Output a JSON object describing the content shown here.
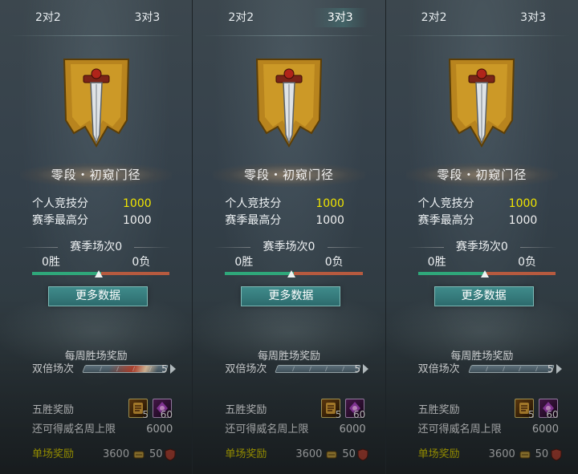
{
  "panels": [
    {
      "tabs": {
        "two_v_two": "2对2",
        "three_v_three": "3对3",
        "active": "none"
      },
      "rank_title": "零段・初窥门径",
      "personal_score_label": "个人竞技分",
      "personal_score": "1000",
      "season_best_label": "赛季最高分",
      "season_best": "1000",
      "season_matches": "赛季场次0",
      "wins": "0胜",
      "losses": "0负",
      "more_data": "更多数据",
      "weekly_title": "每周胜场奖励",
      "double_label": "双倍场次",
      "double_count": "5",
      "double_active": true,
      "five_win_label": "五胜奖励",
      "item_scroll_count": "5",
      "item_gem_count": "60",
      "cap_label": "还可得威名周上限",
      "cap_value": "6000",
      "single_label": "单场奖励",
      "single_value1": "3600",
      "single_value2": "50"
    },
    {
      "tabs": {
        "two_v_two": "2对2",
        "three_v_three": "3对3",
        "active": "three_v_three"
      },
      "rank_title": "零段・初窥门径",
      "personal_score_label": "个人竞技分",
      "personal_score": "1000",
      "season_best_label": "赛季最高分",
      "season_best": "1000",
      "season_matches": "赛季场次0",
      "wins": "0胜",
      "losses": "0负",
      "more_data": "更多数据",
      "weekly_title": "每周胜场奖励",
      "double_label": "双倍场次",
      "double_count": "5",
      "double_active": false,
      "five_win_label": "五胜奖励",
      "item_scroll_count": "5",
      "item_gem_count": "60",
      "cap_label": "还可得威名周上限",
      "cap_value": "6000",
      "single_label": "单场奖励",
      "single_value1": "3600",
      "single_value2": "50"
    },
    {
      "tabs": {
        "two_v_two": "2对2",
        "three_v_three": "3对3",
        "active": "none"
      },
      "rank_title": "零段・初窥门径",
      "personal_score_label": "个人竞技分",
      "personal_score": "1000",
      "season_best_label": "赛季最高分",
      "season_best": "1000",
      "season_matches": "赛季场次0",
      "wins": "0胜",
      "losses": "0负",
      "more_data": "更多数据",
      "weekly_title": "每周胜场奖励",
      "double_label": "双倍场次",
      "double_count": "5",
      "double_active": false,
      "five_win_label": "五胜奖励",
      "item_scroll_count": "5",
      "item_gem_count": "60",
      "cap_label": "还可得威名周上限",
      "cap_value": "6000",
      "single_label": "单场奖励",
      "single_value1": "3600",
      "single_value2": "50"
    }
  ],
  "colors": {
    "score_yellow": "#f0e400",
    "win_green": "#2fa77a",
    "loss_red": "#b65a3f",
    "button_teal": "#2d6c6e",
    "emblem_gold": "#c9941f"
  },
  "icons": {
    "emblem": "sword-banner-icon",
    "scroll_item": "scroll-item-icon",
    "gem_item": "gem-item-icon",
    "coin": "coin-icon",
    "shield": "shield-icon"
  }
}
